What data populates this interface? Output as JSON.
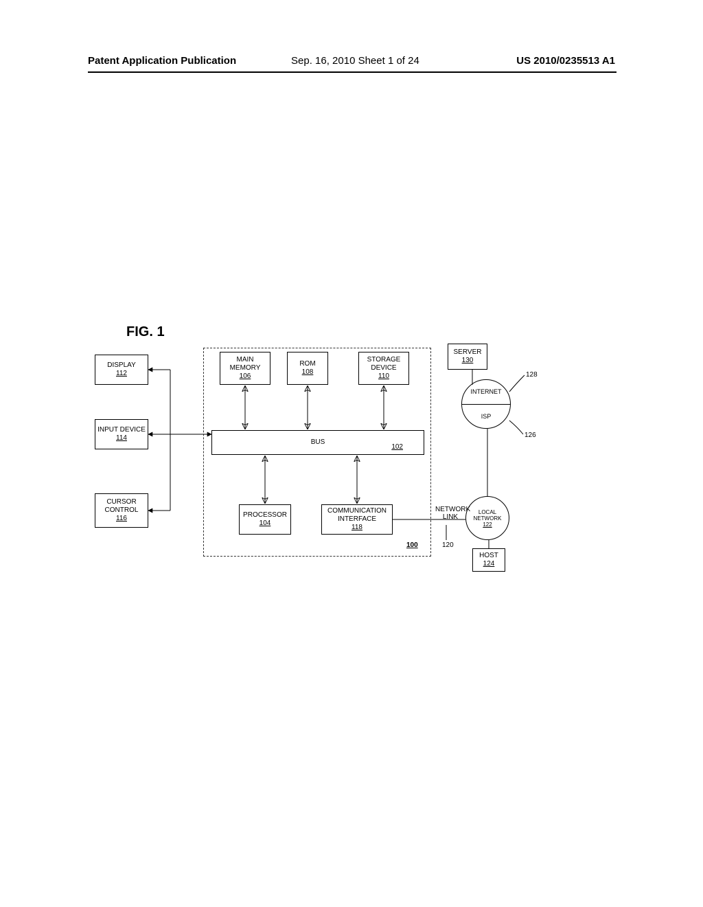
{
  "header": {
    "left": "Patent Application Publication",
    "mid": "Sep. 16, 2010  Sheet 1 of 24",
    "right": "US 2010/0235513 A1"
  },
  "figure_title": "FIG. 1",
  "blocks": {
    "display": {
      "label": "DISPLAY",
      "ref": "112"
    },
    "input_device": {
      "label": "INPUT DEVICE",
      "ref": "114"
    },
    "cursor_control": {
      "label1": "CURSOR",
      "label2": "CONTROL",
      "ref": "116"
    },
    "main_memory": {
      "label1": "MAIN",
      "label2": "MEMORY",
      "ref": "106"
    },
    "rom": {
      "label": "ROM",
      "ref": "108"
    },
    "storage_device": {
      "label1": "STORAGE",
      "label2": "DEVICE",
      "ref": "110"
    },
    "bus": {
      "label": "BUS",
      "ref": "102"
    },
    "processor": {
      "label": "PROCESSOR",
      "ref": "104"
    },
    "comm_if": {
      "label1": "COMMUNICATION",
      "label2": "INTERFACE",
      "ref": "118"
    },
    "server": {
      "label": "SERVER",
      "ref": "130"
    },
    "host": {
      "label": "HOST",
      "ref": "124"
    },
    "network_link": {
      "label1": "NETWORK",
      "label2": "LINK",
      "ref": "120"
    },
    "local_network": {
      "label1": "LOCAL",
      "label2": "NETWORK",
      "ref": "122"
    },
    "internet": {
      "label": "INTERNET"
    },
    "isp": {
      "label": "ISP"
    },
    "system": {
      "ref": "100"
    }
  },
  "callouts": {
    "c128": "128",
    "c126": "126"
  }
}
